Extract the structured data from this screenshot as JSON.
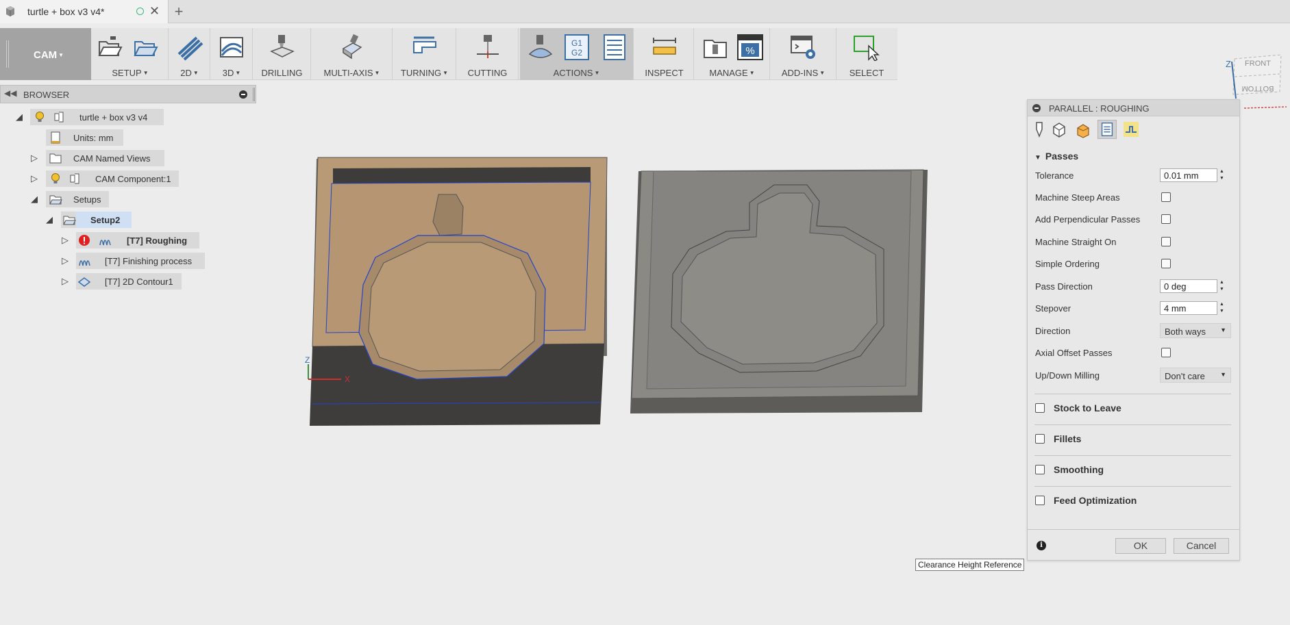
{
  "document": {
    "tab_title": "turtle + box v3 v4*",
    "new_tab_symbol": "+",
    "close_symbol": "✕"
  },
  "toolbar": {
    "workspace": "CAM",
    "groups": [
      {
        "label": "SETUP"
      },
      {
        "label": "2D"
      },
      {
        "label": "3D"
      },
      {
        "label": "DRILLING"
      },
      {
        "label": "MULTI-AXIS"
      },
      {
        "label": "TURNING"
      },
      {
        "label": "CUTTING"
      },
      {
        "label": "ACTIONS"
      },
      {
        "label": "INSPECT"
      },
      {
        "label": "MANAGE"
      },
      {
        "label": "ADD-INS"
      },
      {
        "label": "SELECT"
      }
    ],
    "gcode_icon_text": [
      "G1",
      "G2"
    ],
    "percent_icon_text": "%"
  },
  "browser": {
    "title": "BROWSER",
    "items": [
      {
        "label": "turtle + box v3 v4"
      },
      {
        "label": "Units: mm"
      },
      {
        "label": "CAM Named Views"
      },
      {
        "label": "CAM Component:1"
      },
      {
        "label": "Setups"
      },
      {
        "label": "Setup2"
      },
      {
        "label": "[T7] Roughing"
      },
      {
        "label": "[T7] Finishing process"
      },
      {
        "label": "[T7] 2D Contour1"
      }
    ]
  },
  "viewcube": {
    "front": "FRONT",
    "bottom": "BOTTOM",
    "axis_z": "Z"
  },
  "panel": {
    "title": "PARALLEL : ROUGHING",
    "section": "Passes",
    "rows": [
      {
        "label": "Tolerance",
        "value": "0.01 mm"
      },
      {
        "label": "Machine Steep Areas",
        "checked": false
      },
      {
        "label": "Add Perpendicular Passes",
        "checked": false
      },
      {
        "label": "Machine Straight On",
        "checked": false
      },
      {
        "label": "Simple Ordering",
        "checked": false
      },
      {
        "label": "Pass Direction",
        "value": "0 deg"
      },
      {
        "label": "Stepover",
        "value": "4 mm"
      },
      {
        "label": "Direction",
        "value": "Both ways"
      },
      {
        "label": "Axial Offset Passes",
        "checked": false
      },
      {
        "label": "Up/Down Milling",
        "value": "Don't care"
      }
    ],
    "groups": [
      {
        "label": "Stock to Leave",
        "checked": false
      },
      {
        "label": "Fillets",
        "checked": false
      },
      {
        "label": "Smoothing",
        "checked": false
      },
      {
        "label": "Feed Optimization",
        "checked": false
      }
    ],
    "ok": "OK",
    "cancel": "Cancel"
  },
  "tooltip": "Clearance Height Reference",
  "triad": {
    "z": "Z",
    "x": "X"
  },
  "colors": {
    "stock_orange": "#b99a76",
    "part_gray": "#8b8984",
    "error_red": "#e02020",
    "toolpath_blue": "#2244cc"
  }
}
